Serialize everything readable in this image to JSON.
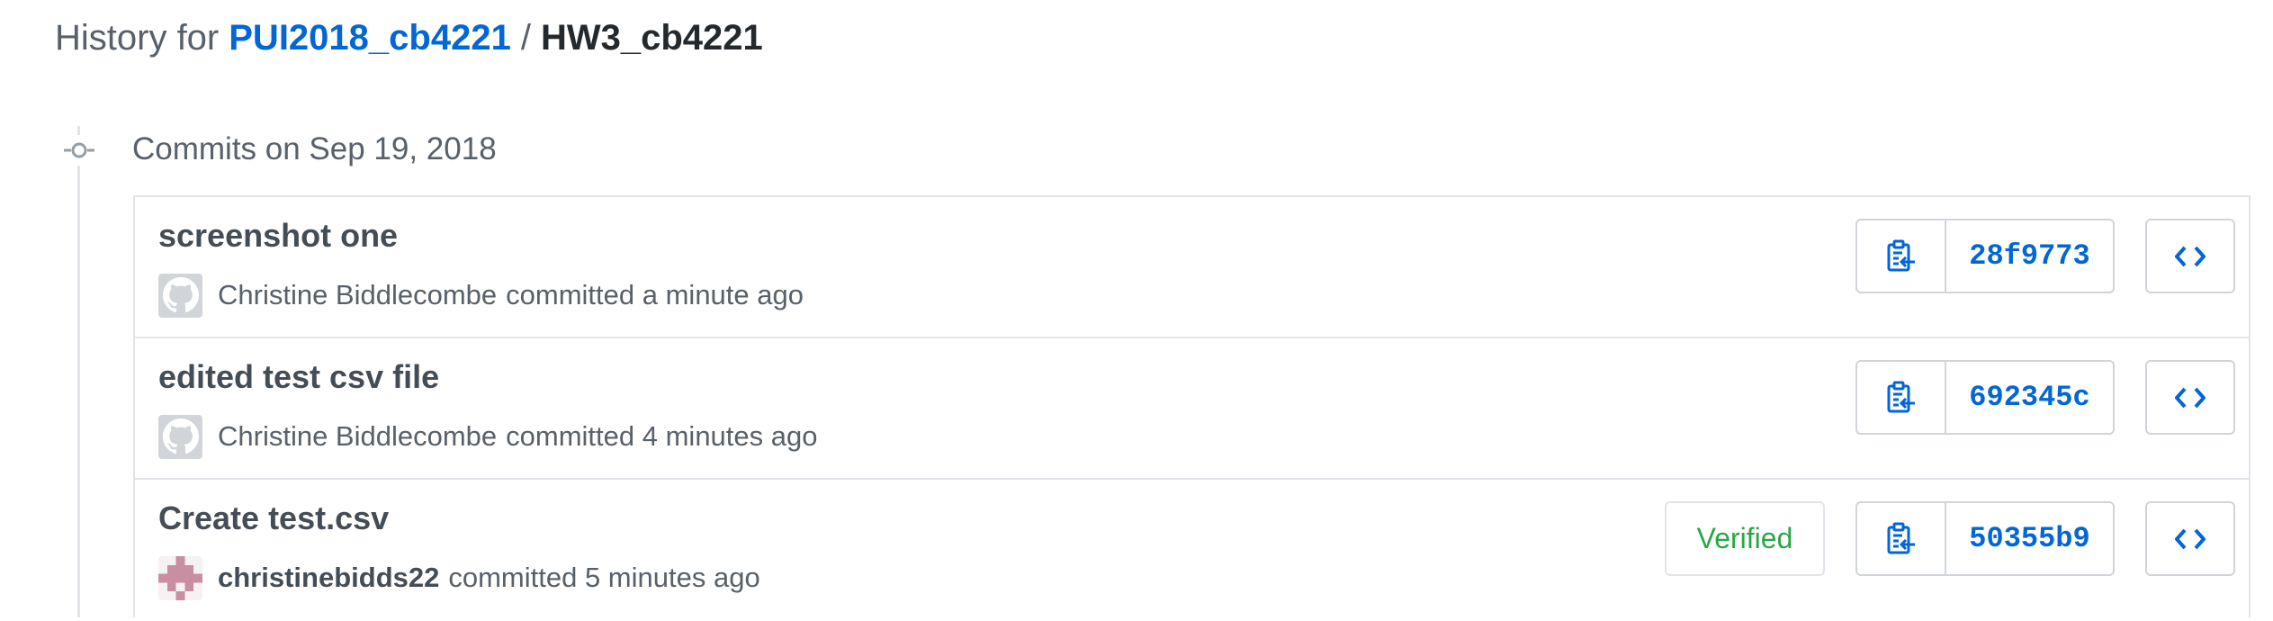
{
  "header": {
    "prefix": "History for",
    "repo": "PUI2018_cb4221",
    "separator": "/",
    "path": "HW3_cb4221"
  },
  "group": {
    "title": "Commits on Sep 19, 2018",
    "icon": "git-commit-icon"
  },
  "commits": [
    {
      "title": "screenshot one",
      "author": "Christine Biddlecombe",
      "action": "committed a minute ago",
      "sha": "28f9773",
      "avatar": "github-octocat-avatar",
      "verified": false
    },
    {
      "title": "edited test csv file",
      "author": "Christine Biddlecombe",
      "action": "committed 4 minutes ago",
      "sha": "692345c",
      "avatar": "github-octocat-avatar",
      "verified": false
    },
    {
      "title": "Create test.csv",
      "author": "christinebidds22",
      "action": "committed 5 minutes ago",
      "sha": "50355b9",
      "avatar": "identicon-avatar",
      "verified": true,
      "verified_label": "Verified"
    }
  ],
  "icons": {
    "copy": "clipboard-copy-icon",
    "browse": "code-brackets-icon"
  },
  "colors": {
    "link": "#0366d6",
    "verified": "#28a745",
    "identicon": "#c98ea2"
  }
}
